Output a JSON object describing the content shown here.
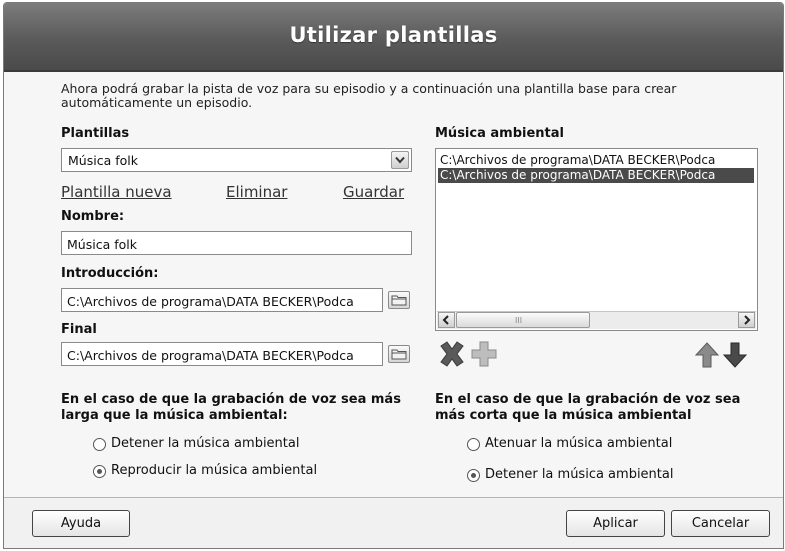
{
  "window": {
    "title": "Utilizar plantillas"
  },
  "description": "Ahora podrá grabar la pista de voz para su episodio y a continuación una plantilla base para crear automáticamente un episodio.",
  "templates": {
    "label": "Plantillas",
    "selected": "Música folk",
    "new_link": "Plantilla nueva",
    "delete_link": "Eliminar",
    "save_link": "Guardar"
  },
  "name": {
    "label": "Nombre:",
    "value": "Música folk"
  },
  "intro": {
    "label": "Introducción:",
    "value": "C:\\Archivos de programa\\DATA BECKER\\Podca"
  },
  "final": {
    "label": "Final",
    "value": "C:\\Archivos de programa\\DATA BECKER\\Podca"
  },
  "ambient": {
    "label": "Música ambiental",
    "items": [
      {
        "text": "C:\\Archivos de programa\\DATA BECKER\\Podca",
        "selected": false
      },
      {
        "text": "C:\\Archivos de programa\\DATA BECKER\\Podca",
        "selected": true
      }
    ],
    "scroll_thumb_glyph": "III"
  },
  "longer": {
    "heading": "En el caso de que la grabación de voz sea más larga que la música ambiental:",
    "options": [
      {
        "label": "Detener la música ambiental",
        "checked": false
      },
      {
        "label": "Reproducir la música ambiental",
        "checked": true
      }
    ]
  },
  "shorter": {
    "heading": "En el caso de que la grabación de voz sea más corta que la música ambiental",
    "options": [
      {
        "label": "Atenuar la música ambiental",
        "checked": false
      },
      {
        "label": "Detener la música ambiental",
        "checked": true
      }
    ]
  },
  "footer": {
    "help": "Ayuda",
    "apply": "Aplicar",
    "cancel": "Cancelar"
  },
  "icons": [
    "delete-x-icon",
    "add-plus-icon",
    "move-up-arrow-icon",
    "move-down-arrow-icon",
    "folder-icon",
    "chevron-down-icon"
  ]
}
